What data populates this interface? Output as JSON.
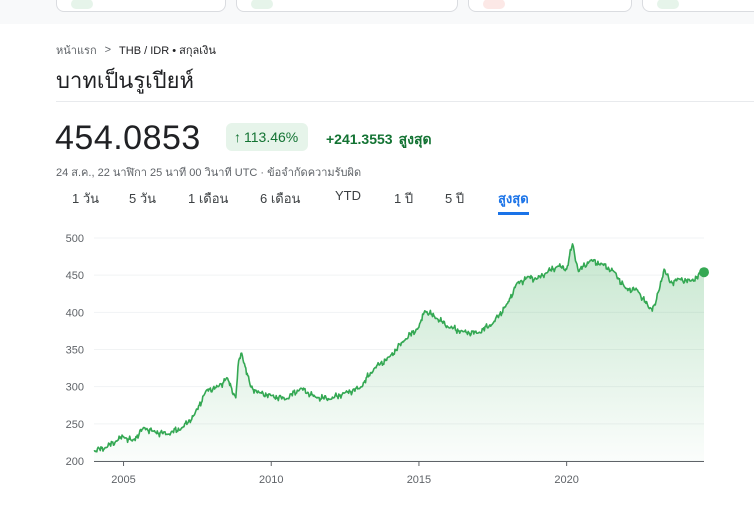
{
  "colors": {
    "accent": "#1a73e8",
    "positive": "#137333",
    "positive_bg": "#e6f4ea",
    "line": "#34a853"
  },
  "breadcrumb": {
    "home": "หน้าแรก",
    "current": "THB / IDR • สกุลเงิน"
  },
  "title": "บาทเป็นรูเปียห์",
  "quote": {
    "price": "454.0853",
    "percent_change": "113.46%",
    "abs_change": "+241.3553",
    "period": "สูงสุด",
    "timestamp": "24 ส.ค., 22 นาฬิกา 25 นาที 00 วินาที UTC · ข้อจำกัดความรับผิด"
  },
  "tabs": [
    {
      "label": "1 วัน",
      "active": false
    },
    {
      "label": "5 วัน",
      "active": false
    },
    {
      "label": "1 เดือน",
      "active": false
    },
    {
      "label": "6 เดือน",
      "active": false
    },
    {
      "label": "YTD",
      "active": false
    },
    {
      "label": "1 ปี",
      "active": false
    },
    {
      "label": "5 ปี",
      "active": false
    },
    {
      "label": "สูงสุด",
      "active": true
    }
  ],
  "chart_data": {
    "type": "area",
    "x_ticks": [
      2005,
      2010,
      2015,
      2020
    ],
    "y_ticks": [
      200,
      250,
      300,
      350,
      400,
      450,
      500
    ],
    "xlim": [
      2004.0,
      2024.65
    ],
    "ylim": [
      200,
      500
    ],
    "grid": true,
    "points": [
      [
        2004.0,
        213
      ],
      [
        2004.4,
        218
      ],
      [
        2004.8,
        228
      ],
      [
        2005.0,
        233
      ],
      [
        2005.3,
        227
      ],
      [
        2005.7,
        245
      ],
      [
        2006.0,
        240
      ],
      [
        2006.5,
        236
      ],
      [
        2007.0,
        245
      ],
      [
        2007.4,
        262
      ],
      [
        2007.8,
        295
      ],
      [
        2008.2,
        300
      ],
      [
        2008.5,
        312
      ],
      [
        2008.8,
        285
      ],
      [
        2008.9,
        335
      ],
      [
        2009.0,
        345
      ],
      [
        2009.3,
        300
      ],
      [
        2009.6,
        292
      ],
      [
        2010.0,
        288
      ],
      [
        2010.5,
        283
      ],
      [
        2011.0,
        298
      ],
      [
        2011.5,
        286
      ],
      [
        2012.0,
        283
      ],
      [
        2012.5,
        292
      ],
      [
        2013.0,
        298
      ],
      [
        2013.5,
        325
      ],
      [
        2014.0,
        340
      ],
      [
        2014.5,
        362
      ],
      [
        2015.0,
        380
      ],
      [
        2015.2,
        402
      ],
      [
        2015.6,
        392
      ],
      [
        2016.0,
        380
      ],
      [
        2016.5,
        374
      ],
      [
        2017.0,
        372
      ],
      [
        2017.5,
        385
      ],
      [
        2018.0,
        412
      ],
      [
        2018.3,
        438
      ],
      [
        2018.7,
        448
      ],
      [
        2019.0,
        445
      ],
      [
        2019.3,
        453
      ],
      [
        2019.7,
        462
      ],
      [
        2020.0,
        458
      ],
      [
        2020.2,
        492
      ],
      [
        2020.4,
        455
      ],
      [
        2020.8,
        470
      ],
      [
        2021.2,
        465
      ],
      [
        2021.6,
        455
      ],
      [
        2022.0,
        432
      ],
      [
        2022.4,
        430
      ],
      [
        2022.8,
        405
      ],
      [
        2023.0,
        410
      ],
      [
        2023.3,
        458
      ],
      [
        2023.5,
        440
      ],
      [
        2023.8,
        445
      ],
      [
        2024.2,
        442
      ],
      [
        2024.65,
        454
      ]
    ]
  }
}
